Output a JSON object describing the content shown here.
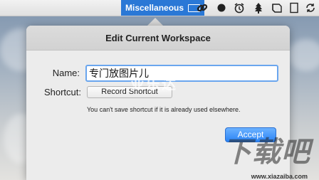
{
  "menubar": {
    "workspace_label": "Miscellaneous",
    "icons": [
      "link-icon",
      "record-icon",
      "alarm-clock-icon",
      "tree-icon",
      "book-icon",
      "document-icon",
      "sync-icon"
    ]
  },
  "dialog": {
    "title": "Edit Current Workspace",
    "name_label": "Name:",
    "name_value": "专门放图片儿",
    "shortcut_label": "Shortcut:",
    "record_shortcut_label": "Record Shortcut",
    "hint_text": "You can't save shortcut if it is already used elsewhere.",
    "accept_label": "Accept"
  },
  "watermark": {
    "mid_text": "亚乐达",
    "logo_text": "下载吧",
    "url": "www.xiazaiba.com"
  },
  "colors": {
    "accent": "#2a78d6",
    "accept_button": "#3a8ef7",
    "field_focus": "#6aa6ee"
  }
}
